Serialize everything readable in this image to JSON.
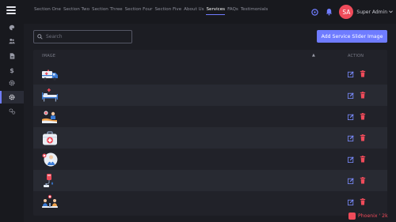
{
  "nav": {
    "items": [
      "Section One",
      "Section Two",
      "Section Three",
      "Section Four",
      "Section Five",
      "About Us",
      "Services",
      "FAQs",
      "Testimonials"
    ],
    "active": "Services"
  },
  "user": {
    "initials": "SA",
    "name": "Super Admin"
  },
  "search": {
    "placeholder": "Search",
    "value": ""
  },
  "actions": {
    "add_label": "Add Service Slider Image"
  },
  "table": {
    "columns": {
      "image": "IMAGE",
      "action": "ACTION"
    },
    "rows": [
      {
        "image_icon": "ambulance-icon"
      },
      {
        "image_icon": "hospital-bed-icon"
      },
      {
        "image_icon": "medical-care-icon"
      },
      {
        "image_icon": "first-aid-kit-icon"
      },
      {
        "image_icon": "doctor-consult-icon"
      },
      {
        "image_icon": "blood-transfusion-icon"
      },
      {
        "image_icon": "patients-icon"
      }
    ]
  },
  "sidebar": {
    "icons": [
      "palette-icon",
      "users-icon",
      "document-icon",
      "dollar-icon",
      "settings-icon",
      "gear-icon",
      "cogs-icon"
    ],
    "active_index": 5
  },
  "watermark": {
    "text": "Phoenix ' 2k"
  },
  "colors": {
    "accent": "#6f7cff",
    "danger": "#ef4b5a",
    "edit": "#7b8cff",
    "background": "#1c1d23"
  }
}
